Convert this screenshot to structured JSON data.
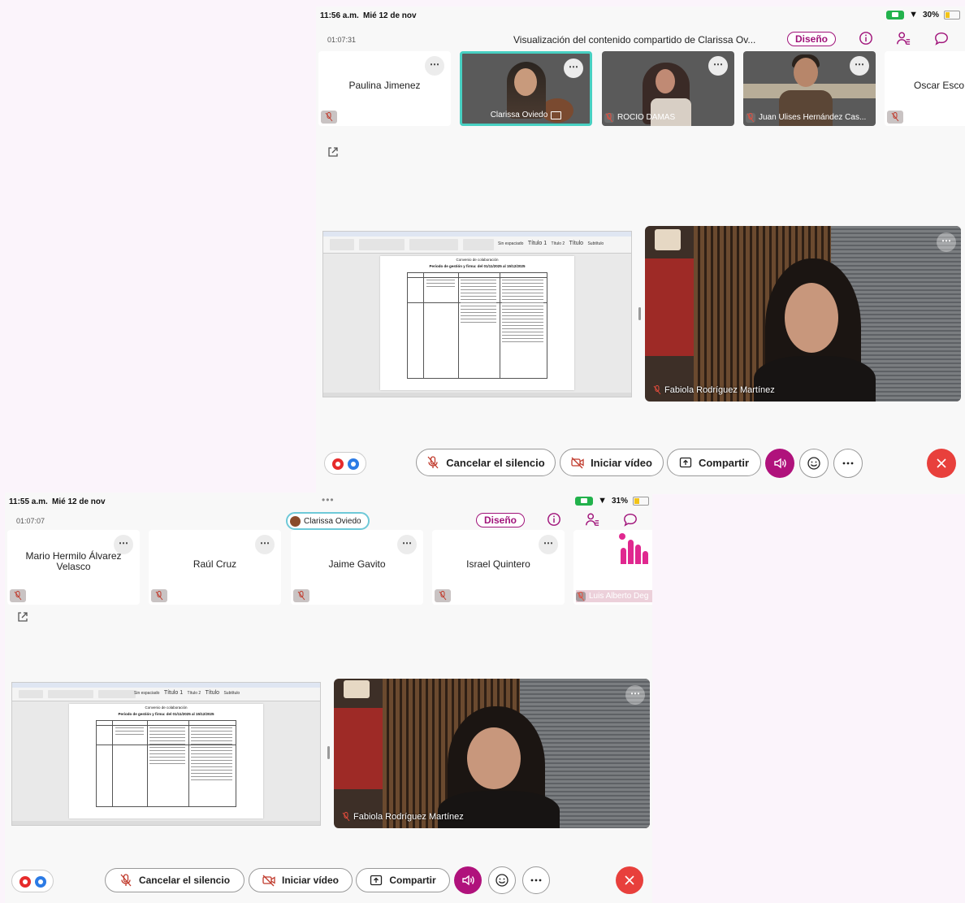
{
  "colors": {
    "accent": "#a0137a",
    "active_speaker": "#48d0c2",
    "leave": "#e8403c",
    "battery": "#f2c418",
    "camera_indicator": "#22b24c"
  },
  "top": {
    "status": {
      "time": "11:56 a.m.",
      "date": "Mié 12 de nov",
      "battery": "30%",
      "battery_level": 0.3
    },
    "meeting": {
      "elapsed": "01:07:31",
      "title": "Visualización del contenido compartido de Clarissa Ov...",
      "layout_button": "Diseño"
    },
    "participants": [
      {
        "name": "Paulina Jimenez",
        "video": false
      },
      {
        "name": "Clarissa Oviedo",
        "video": true,
        "active": true
      },
      {
        "name": "ROCIO DAMAS",
        "video": true
      },
      {
        "name": "Juan Ulises Hernández Cas...",
        "video": true
      },
      {
        "name": "Oscar Esco",
        "video": false
      }
    ],
    "main_video_name": "Fabiola Rodríguez Martínez",
    "toolbar": {
      "unmute": "Cancelar el silencio",
      "start_video": "Iniciar vídeo",
      "share": "Compartir"
    }
  },
  "bottom": {
    "status": {
      "time": "11:55 a.m.",
      "date": "Mié 12 de nov",
      "battery": "31%",
      "battery_level": 0.31
    },
    "meeting": {
      "elapsed": "01:07:07",
      "presenter": "Clarissa Oviedo",
      "layout_button": "Diseño"
    },
    "participants": [
      {
        "name": "Mario Hermilo Álvarez Velasco",
        "video": false
      },
      {
        "name": "Raúl Cruz",
        "video": false
      },
      {
        "name": "Jaime Gavito",
        "video": false
      },
      {
        "name": "Israel Quintero",
        "video": false
      },
      {
        "name": "Luis Alberto Deg",
        "video": false,
        "logo": true
      }
    ],
    "main_video_name": "Fabiola Rodríguez Martínez",
    "toolbar": {
      "unmute": "Cancelar el silencio",
      "start_video": "Iniciar vídeo",
      "share": "Compartir"
    }
  },
  "shared_doc": {
    "heading": "Convenio de colaboración",
    "subheading": "Periodo de gestión y firma: del 01/11/2025 al 15/12/2025",
    "ribbon_styles": [
      "Sin espaciado",
      "Título 1",
      "Título 2",
      "Título",
      "Subtítulo"
    ]
  },
  "icons": [
    "info-icon",
    "participants-icon",
    "chat-icon",
    "popout-icon",
    "mic-off-icon",
    "video-off-icon",
    "share-icon",
    "speaker-icon",
    "reaction-icon",
    "more-icon",
    "leave-icon",
    "wifi-icon",
    "battery-icon"
  ]
}
